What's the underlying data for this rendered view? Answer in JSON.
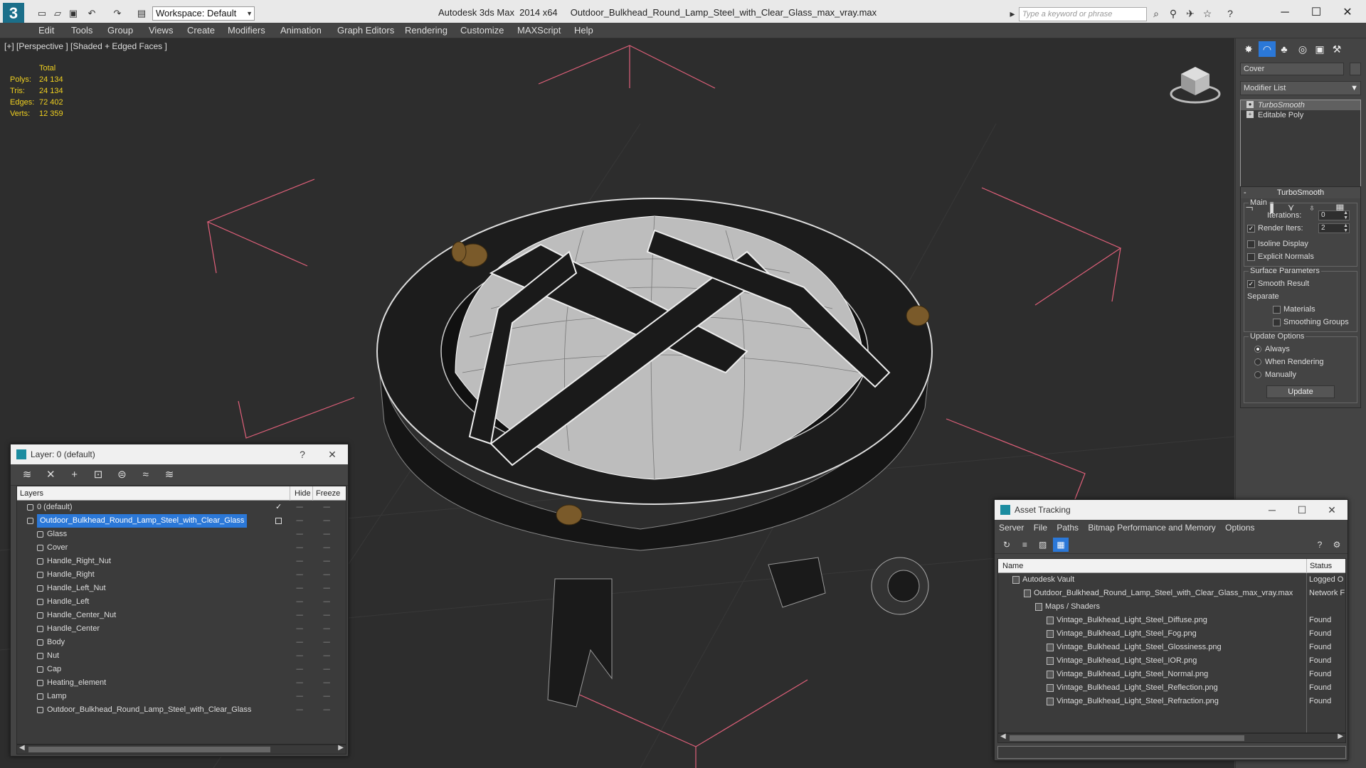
{
  "titlebar": {
    "app_title": "Autodesk 3ds Max  2014 x64     Outdoor_Bulkhead_Round_Lamp_Steel_with_Clear_Glass_max_vray.max",
    "workspace_label": "Workspace: Default",
    "search_placeholder": "Type a keyword or phrase",
    "minimize": "─",
    "maximize": "☐",
    "close": "✕"
  },
  "menubar": {
    "items": [
      "Edit",
      "Tools",
      "Group",
      "Views",
      "Create",
      "Modifiers",
      "Animation",
      "Graph Editors",
      "Rendering",
      "Customize",
      "MAXScript",
      "Help"
    ]
  },
  "viewport": {
    "label": "[+] [Perspective ] [Shaded + Edged Faces ]",
    "stats": {
      "header": "Total",
      "polys_label": "Polys:",
      "polys": "24 134",
      "tris_label": "Tris:",
      "tris": "24 134",
      "edges_label": "Edges:",
      "edges": "72 402",
      "verts_label": "Verts:",
      "verts": "12 359"
    }
  },
  "command_panel": {
    "object_name": "Cover",
    "modifier_list": "Modifier List",
    "stack": [
      "TurboSmooth",
      "Editable Poly"
    ],
    "turbosmooth": {
      "title": "TurboSmooth",
      "main_group": "Main",
      "iterations_label": "Iterations:",
      "iterations": "0",
      "render_iters_label": "Render Iters:",
      "render_iters": "2",
      "render_iters_checked": true,
      "isoline_label": "Isoline Display",
      "isoline_checked": false,
      "explicit_normals_label": "Explicit Normals",
      "explicit_normals_checked": false,
      "surface_group": "Surface Parameters",
      "smooth_result_label": "Smooth Result",
      "smooth_result_checked": true,
      "separate_label": "Separate",
      "materials_label": "Materials",
      "materials_checked": false,
      "smoothing_groups_label": "Smoothing Groups",
      "smoothing_groups_checked": false,
      "update_group": "Update Options",
      "always_label": "Always",
      "when_rendering_label": "When Rendering",
      "manually_label": "Manually",
      "update_mode": "Always",
      "update_button": "Update"
    }
  },
  "layer_window": {
    "title": "Layer: 0 (default)",
    "help": "?",
    "close": "✕",
    "col_layers": "Layers",
    "col_hide": "Hide",
    "col_freeze": "Freeze",
    "rows": [
      {
        "name": "0 (default)",
        "level": 0,
        "type": "layer",
        "active": true
      },
      {
        "name": "Outdoor_Bulkhead_Round_Lamp_Steel_with_Clear_Glass",
        "level": 0,
        "type": "layer",
        "selected": true
      },
      {
        "name": "Glass",
        "level": 1,
        "type": "object"
      },
      {
        "name": "Cover",
        "level": 1,
        "type": "object"
      },
      {
        "name": "Handle_Right_Nut",
        "level": 1,
        "type": "object"
      },
      {
        "name": "Handle_Right",
        "level": 1,
        "type": "object"
      },
      {
        "name": "Handle_Left_Nut",
        "level": 1,
        "type": "object"
      },
      {
        "name": "Handle_Left",
        "level": 1,
        "type": "object"
      },
      {
        "name": "Handle_Center_Nut",
        "level": 1,
        "type": "object"
      },
      {
        "name": "Handle_Center",
        "level": 1,
        "type": "object"
      },
      {
        "name": "Body",
        "level": 1,
        "type": "object"
      },
      {
        "name": "Nut",
        "level": 1,
        "type": "object"
      },
      {
        "name": "Cap",
        "level": 1,
        "type": "object"
      },
      {
        "name": "Heating_element",
        "level": 1,
        "type": "object"
      },
      {
        "name": "Lamp",
        "level": 1,
        "type": "object"
      },
      {
        "name": "Outdoor_Bulkhead_Round_Lamp_Steel_with_Clear_Glass",
        "level": 1,
        "type": "object"
      }
    ]
  },
  "asset_window": {
    "title": "Asset Tracking",
    "menu": [
      "Server",
      "File",
      "Paths",
      "Bitmap Performance and Memory",
      "Options"
    ],
    "col_name": "Name",
    "col_status": "Status",
    "rows": [
      {
        "name": "Autodesk Vault",
        "status": "Logged O",
        "level": 1
      },
      {
        "name": "Outdoor_Bulkhead_Round_Lamp_Steel_with_Clear_Glass_max_vray.max",
        "status": "Network F",
        "level": 2
      },
      {
        "name": "Maps / Shaders",
        "status": "",
        "level": 3
      },
      {
        "name": "Vintage_Bulkhead_Light_Steel_Diffuse.png",
        "status": "Found",
        "level": 4
      },
      {
        "name": "Vintage_Bulkhead_Light_Steel_Fog.png",
        "status": "Found",
        "level": 4
      },
      {
        "name": "Vintage_Bulkhead_Light_Steel_Glossiness.png",
        "status": "Found",
        "level": 4
      },
      {
        "name": "Vintage_Bulkhead_Light_Steel_IOR.png",
        "status": "Found",
        "level": 4
      },
      {
        "name": "Vintage_Bulkhead_Light_Steel_Normal.png",
        "status": "Found",
        "level": 4
      },
      {
        "name": "Vintage_Bulkhead_Light_Steel_Reflection.png",
        "status": "Found",
        "level": 4
      },
      {
        "name": "Vintage_Bulkhead_Light_Steel_Refraction.png",
        "status": "Found",
        "level": 4
      }
    ]
  },
  "colors": {
    "accent": "#2b78d8",
    "stats_text": "#f0d020",
    "bbox_lines": "#e0607a",
    "viewport_bg": "#2d2d2d"
  }
}
